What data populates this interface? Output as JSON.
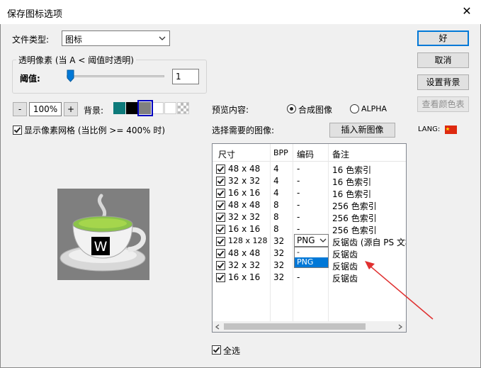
{
  "window": {
    "title": "保存图标选项",
    "close_glyph": "✕"
  },
  "file_type": {
    "label": "文件类型:",
    "value": "图标"
  },
  "transparency": {
    "group_label": "透明像素 (当 A < 阈值时透明)",
    "threshold_label": "阈值:",
    "threshold_value": "1",
    "slider_level": 0.0
  },
  "zoom": {
    "minus": "-",
    "value": "100%",
    "plus": "+"
  },
  "background": {
    "label": "背景:",
    "swatches": [
      "#0d7a7a",
      "#000000",
      "#808080",
      "#ffffff",
      "#ffffff",
      "checker"
    ],
    "selected_index": 2
  },
  "show_grid": {
    "label": "显示像素网格 (当比例 >= 400% 时)",
    "checked": true
  },
  "preview": {
    "label": "预览内容:",
    "option_composite": "合成图像",
    "option_alpha": "ALPHA",
    "selected": "composite",
    "icon_letter": "W"
  },
  "select_images_label": "选择需要的图像:",
  "insert_button": "插入新图像",
  "lang": {
    "label": "LANG:",
    "flag": "cn-flag-icon"
  },
  "table": {
    "headers": [
      "尺寸",
      "BPP",
      "编码",
      "备注"
    ],
    "rows": [
      {
        "size": "48 x 48",
        "bpp": "4",
        "enc": "-",
        "note": "16 色索引",
        "checked": true
      },
      {
        "size": "32 x 32",
        "bpp": "4",
        "enc": "-",
        "note": "16 色索引",
        "checked": true
      },
      {
        "size": "16 x 16",
        "bpp": "4",
        "enc": "-",
        "note": "16 色索引",
        "checked": true
      },
      {
        "size": "48 x 48",
        "bpp": "8",
        "enc": "-",
        "note": "256 色索引",
        "checked": true
      },
      {
        "size": "32 x 32",
        "bpp": "8",
        "enc": "-",
        "note": "256 色索引",
        "checked": true
      },
      {
        "size": "16 x 16",
        "bpp": "8",
        "enc": "-",
        "note": "256 色索引",
        "checked": true
      },
      {
        "size": "128 x 128 !",
        "bpp": "32",
        "enc": "PNG",
        "note": "反锯齿 (源自 PS 文档",
        "checked": true
      },
      {
        "size": "48 x 48",
        "bpp": "32",
        "enc": "",
        "note": "反锯齿",
        "checked": true
      },
      {
        "size": "32 x 32",
        "bpp": "32",
        "enc": "",
        "note": "反锯齿",
        "checked": true
      },
      {
        "size": "16 x 16",
        "bpp": "32",
        "enc": "-",
        "note": "反锯齿",
        "checked": true
      }
    ],
    "dropdown_options": [
      "-",
      "PNG"
    ],
    "dropdown_selected": "PNG"
  },
  "select_all": {
    "label": "全选",
    "checked": true
  },
  "buttons": {
    "ok": "好",
    "cancel": "取消",
    "set_background": "设置背景",
    "view_color_table": "查看颜色表"
  },
  "colors": {
    "accent": "#0078d7",
    "annotation_arrow": "#e03030"
  }
}
